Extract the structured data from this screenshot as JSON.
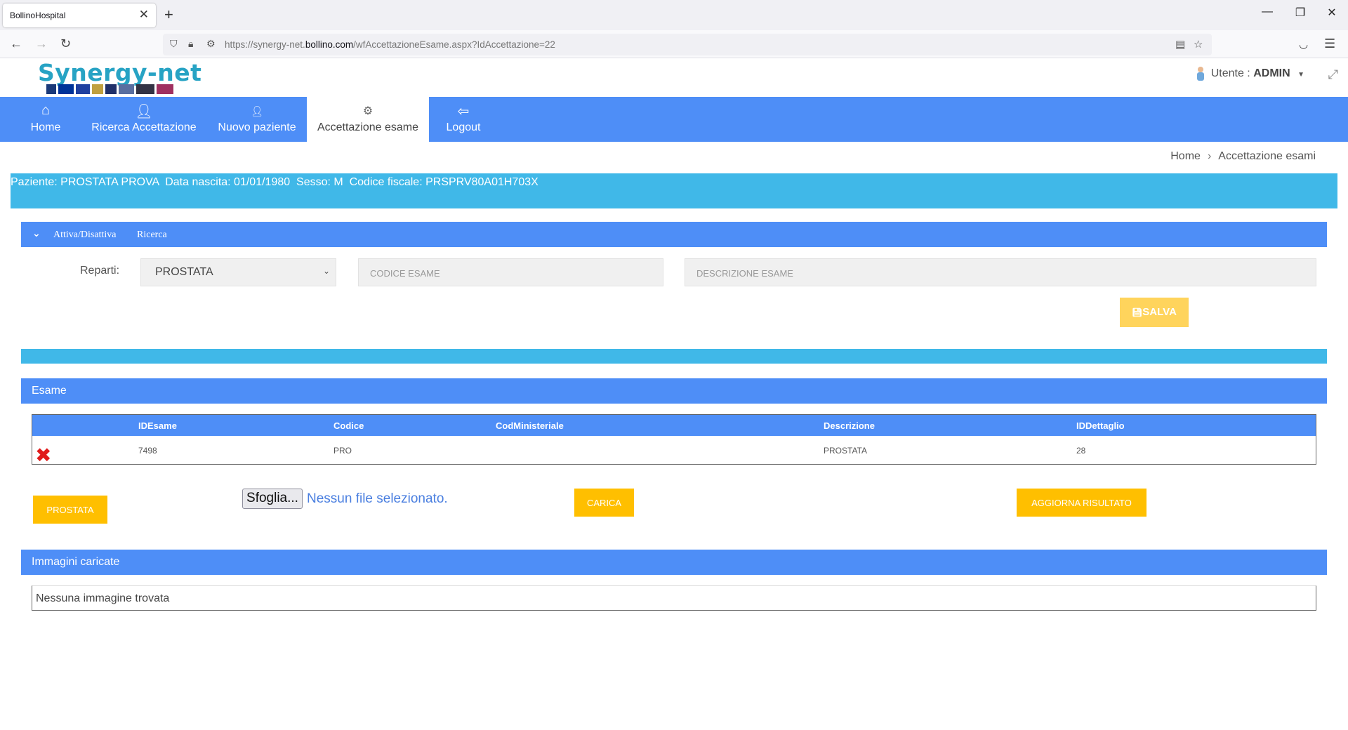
{
  "browser": {
    "tab_title": "BollinoHospital",
    "url_prefix": "https://synergy-net.",
    "url_domain": "bollino.com",
    "url_path": "/wfAccettazioneEsame.aspx?IdAccettazione=22"
  },
  "header": {
    "logo": "Synergy-net",
    "user_label": "Utente : ",
    "user_name": "ADMIN"
  },
  "menu": {
    "items": [
      {
        "label": "Home",
        "icon": "home-icon"
      },
      {
        "label": "Ricerca Accettazione",
        "icon": "user-search-icon"
      },
      {
        "label": "Nuovo paziente",
        "icon": "user-icon"
      },
      {
        "label": "Accettazione esame",
        "icon": "gear-icon"
      },
      {
        "label": "Logout",
        "icon": "logout-icon"
      }
    ],
    "active": "Accettazione esame"
  },
  "breadcrumb": {
    "home": "Home",
    "current": "Accettazione esami"
  },
  "patient": {
    "info": "Paziente: PROSTATA PROVA  Data nascita: 01/01/1980  Sesso: M  Codice fiscale: PRSPRV80A01H703X"
  },
  "search": {
    "toggle_label": "Attiva/Disattiva",
    "toggle_label2": "Ricerca",
    "reparti_label": "Reparti:",
    "reparti_selected": "PROSTATA",
    "codice_placeholder": "CODICE ESAME",
    "descrizione_placeholder": "DESCRIZIONE ESAME",
    "save_label": "SALVA"
  },
  "esame": {
    "title": "Esame",
    "columns": [
      "IDEsame",
      "Codice",
      "CodMinisteriale",
      "Descrizione",
      "IDDettaglio"
    ],
    "rows": [
      {
        "IDEsame": "7498",
        "Codice": "PRO",
        "CodMinisteriale": "",
        "Descrizione": "PROSTATA",
        "IDDettaglio": "28"
      }
    ]
  },
  "actions": {
    "prostata_button": "PROSTATA",
    "browse_button": "Sfoglia...",
    "no_file": "Nessun file selezionato.",
    "carica_button": "CARICA",
    "aggiorna_button": "AGGIORNA RISULTATO"
  },
  "images": {
    "title": "Immagini caricate",
    "empty_text": "Nessuna immagine trovata"
  },
  "colors": {
    "primary_blue": "#4e8ef7",
    "cyan": "#40b8e8",
    "yellow": "#ffbf00",
    "delete_red": "#e01b1b"
  }
}
